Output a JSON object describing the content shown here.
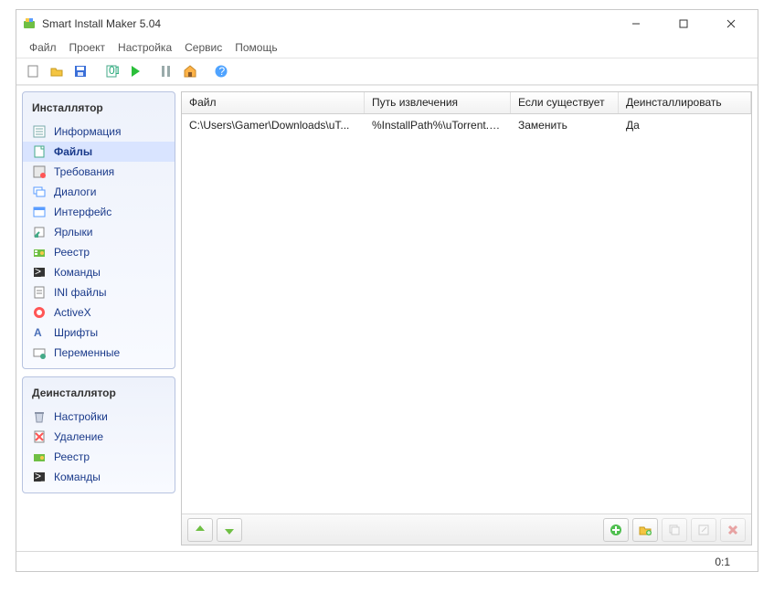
{
  "window": {
    "title": "Smart Install Maker 5.04"
  },
  "menu": {
    "file": "Файл",
    "project": "Проект",
    "settings": "Настройка",
    "service": "Сервис",
    "help": "Помощь"
  },
  "sidebar": {
    "installer": {
      "header": "Инсталлятор",
      "items": [
        {
          "label": "Информация"
        },
        {
          "label": "Файлы"
        },
        {
          "label": "Требования"
        },
        {
          "label": "Диалоги"
        },
        {
          "label": "Интерфейс"
        },
        {
          "label": "Ярлыки"
        },
        {
          "label": "Реестр"
        },
        {
          "label": "Команды"
        },
        {
          "label": "INI файлы"
        },
        {
          "label": "ActiveX"
        },
        {
          "label": "Шрифты"
        },
        {
          "label": "Переменные"
        }
      ]
    },
    "uninstaller": {
      "header": "Деинсталлятор",
      "items": [
        {
          "label": "Настройки"
        },
        {
          "label": "Удаление"
        },
        {
          "label": "Реестр"
        },
        {
          "label": "Команды"
        }
      ]
    }
  },
  "table": {
    "headers": {
      "file": "Файл",
      "extract": "Путь извлечения",
      "exists": "Если существует",
      "uninstall": "Деинсталлировать"
    },
    "rows": [
      {
        "file": "C:\\Users\\Gamer\\Downloads\\uT...",
        "extract": "%InstallPath%\\uTorrent.exe",
        "exists": "Заменить",
        "uninstall": "Да"
      }
    ]
  },
  "status": {
    "ratio": "0:1"
  }
}
